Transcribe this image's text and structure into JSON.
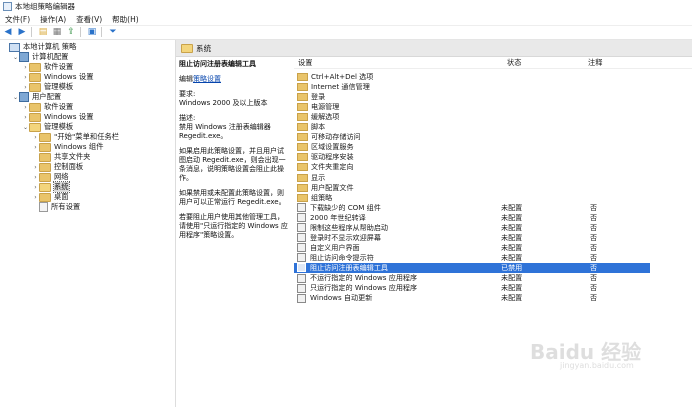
{
  "window": {
    "title": "本地组策略编辑器"
  },
  "menu": [
    "文件(F)",
    "操作(A)",
    "查看(V)",
    "帮助(H)"
  ],
  "toolbar": [
    "back-icon",
    "forward-icon",
    "folder-up-icon",
    "properties-icon",
    "export-icon",
    "help-icon",
    "filter-icon"
  ],
  "tree": [
    {
      "label": "本地计算机 策略",
      "icon": "pc",
      "level": 0,
      "exp": ""
    },
    {
      "label": "计算机配置",
      "icon": "cfg",
      "level": 1,
      "exp": "⌄"
    },
    {
      "label": "软件设置",
      "icon": "folder",
      "level": 2,
      "exp": "›"
    },
    {
      "label": "Windows 设置",
      "icon": "folder",
      "level": 2,
      "exp": "›"
    },
    {
      "label": "管理模板",
      "icon": "folder",
      "level": 2,
      "exp": "›"
    },
    {
      "label": "用户配置",
      "icon": "cfg",
      "level": 1,
      "exp": "⌄"
    },
    {
      "label": "软件设置",
      "icon": "folder",
      "level": 2,
      "exp": "›"
    },
    {
      "label": "Windows 设置",
      "icon": "folder",
      "level": 2,
      "exp": "›"
    },
    {
      "label": "管理模板",
      "icon": "folder-open",
      "level": 2,
      "exp": "⌄"
    },
    {
      "label": "\"开始\"菜单和任务栏",
      "icon": "folder",
      "level": 3,
      "exp": "›"
    },
    {
      "label": "Windows 组件",
      "icon": "folder",
      "level": 3,
      "exp": "›"
    },
    {
      "label": "共享文件夹",
      "icon": "folder",
      "level": 3,
      "exp": ""
    },
    {
      "label": "控制面板",
      "icon": "folder",
      "level": 3,
      "exp": "›"
    },
    {
      "label": "网络",
      "icon": "folder",
      "level": 3,
      "exp": "›"
    },
    {
      "label": "系统",
      "icon": "folder-open",
      "level": 3,
      "exp": "›",
      "selected": true
    },
    {
      "label": "桌面",
      "icon": "folder",
      "level": 3,
      "exp": "›"
    },
    {
      "label": "所有设置",
      "icon": "doc",
      "level": 3,
      "exp": ""
    }
  ],
  "header": {
    "title": "系统"
  },
  "description": {
    "title": "阻止访问注册表编辑工具",
    "edit_prefix": "编辑",
    "edit_link": "策略设置",
    "req_label": "要求:",
    "req_text": "Windows 2000 及以上版本",
    "desc_label": "描述:",
    "desc_text": "禁用 Windows 注册表编辑器 Regedit.exe。",
    "para1": "如果启用此策略设置，并且用户试图启动 Regedit.exe，则会出现一条消息，说明策略设置会阻止此操作。",
    "para2": "如果禁用或未配置此策略设置，则用户可以正常运行 Regedit.exe。",
    "para3": "若要阻止用户使用其他管理工具，请使用\"只运行指定的 Windows 应用程序\"策略设置。"
  },
  "columns": {
    "setting": "设置",
    "state": "状态",
    "comment": "注释"
  },
  "rows": [
    {
      "name": "Ctrl+Alt+Del 选项",
      "kind": "folder",
      "state": "",
      "comment": ""
    },
    {
      "name": "Internet 通信管理",
      "kind": "folder",
      "state": "",
      "comment": ""
    },
    {
      "name": "登录",
      "kind": "folder",
      "state": "",
      "comment": ""
    },
    {
      "name": "电源管理",
      "kind": "folder",
      "state": "",
      "comment": ""
    },
    {
      "name": "缓解选项",
      "kind": "folder",
      "state": "",
      "comment": ""
    },
    {
      "name": "脚本",
      "kind": "folder",
      "state": "",
      "comment": ""
    },
    {
      "name": "可移动存储访问",
      "kind": "folder",
      "state": "",
      "comment": ""
    },
    {
      "name": "区域设置服务",
      "kind": "folder",
      "state": "",
      "comment": ""
    },
    {
      "name": "驱动程序安装",
      "kind": "folder",
      "state": "",
      "comment": ""
    },
    {
      "name": "文件夹重定向",
      "kind": "folder",
      "state": "",
      "comment": ""
    },
    {
      "name": "显示",
      "kind": "folder",
      "state": "",
      "comment": ""
    },
    {
      "name": "用户配置文件",
      "kind": "folder",
      "state": "",
      "comment": ""
    },
    {
      "name": "组策略",
      "kind": "folder",
      "state": "",
      "comment": ""
    },
    {
      "name": "下载缺少的 COM 组件",
      "kind": "setting",
      "state": "未配置",
      "comment": "否"
    },
    {
      "name": "2000 年世纪转译",
      "kind": "setting",
      "state": "未配置",
      "comment": "否"
    },
    {
      "name": "限制这些程序从帮助启动",
      "kind": "setting",
      "state": "未配置",
      "comment": "否"
    },
    {
      "name": "登录时不显示欢迎屏幕",
      "kind": "setting",
      "state": "未配置",
      "comment": "否"
    },
    {
      "name": "自定义用户界面",
      "kind": "setting",
      "state": "未配置",
      "comment": "否"
    },
    {
      "name": "阻止访问命令提示符",
      "kind": "setting",
      "state": "未配置",
      "comment": "否"
    },
    {
      "name": "阻止访问注册表编辑工具",
      "kind": "setting",
      "state": "已禁用",
      "comment": "否",
      "selected": true
    },
    {
      "name": "不运行指定的 Windows 应用程序",
      "kind": "setting",
      "state": "未配置",
      "comment": "否"
    },
    {
      "name": "只运行指定的 Windows 应用程序",
      "kind": "setting",
      "state": "未配置",
      "comment": "否"
    },
    {
      "name": "Windows 自动更新",
      "kind": "setting",
      "state": "未配置",
      "comment": "否"
    }
  ],
  "watermark": {
    "main": "Baidu 经验",
    "sub": "jingyan.baidu.com"
  }
}
